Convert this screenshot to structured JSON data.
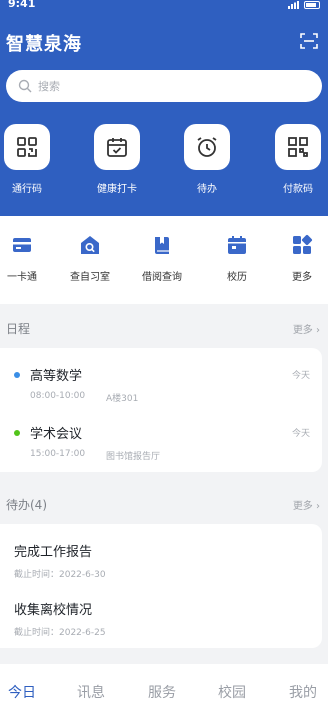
{
  "status": {
    "time": "9:41"
  },
  "app": {
    "title": "智慧泉海"
  },
  "search": {
    "placeholder": "搜索"
  },
  "quick_actions": [
    {
      "label": "通行码",
      "icon": "grid-qr-icon"
    },
    {
      "label": "健康打卡",
      "icon": "calendar-check-icon"
    },
    {
      "label": "待办",
      "icon": "alarm-clock-icon"
    },
    {
      "label": "付款码",
      "icon": "qr-code-icon"
    }
  ],
  "services": [
    {
      "label": "一卡通",
      "icon": "card-icon"
    },
    {
      "label": "查自习室",
      "icon": "house-search-icon"
    },
    {
      "label": "借阅查询",
      "icon": "book-icon"
    },
    {
      "label": "校历",
      "icon": "calendar-icon"
    },
    {
      "label": "更多",
      "icon": "apps-icon"
    }
  ],
  "schedule": {
    "title": "日程",
    "more": "更多 ›",
    "items": [
      {
        "title": "高等数学",
        "time": "08:00-10:00",
        "place": "A楼301",
        "day": "今天",
        "dot_color": "#3a8ee6"
      },
      {
        "title": "学术会议",
        "time": "15:00-17:00",
        "place": "图书馆报告厅",
        "day": "今天",
        "dot_color": "#52c41a"
      }
    ]
  },
  "todos": {
    "title": "待办(4)",
    "more": "更多 ›",
    "items": [
      {
        "title": "完成工作报告",
        "deadline": "截止时间：2022-6-30"
      },
      {
        "title": "收集离校情况",
        "deadline": "截止时间：2022-6-25"
      }
    ]
  },
  "tabs": [
    "今日",
    "讯息",
    "服务",
    "校园",
    "我的"
  ],
  "colors": {
    "primary": "#2f5fc0",
    "background": "#f2f3f5"
  }
}
